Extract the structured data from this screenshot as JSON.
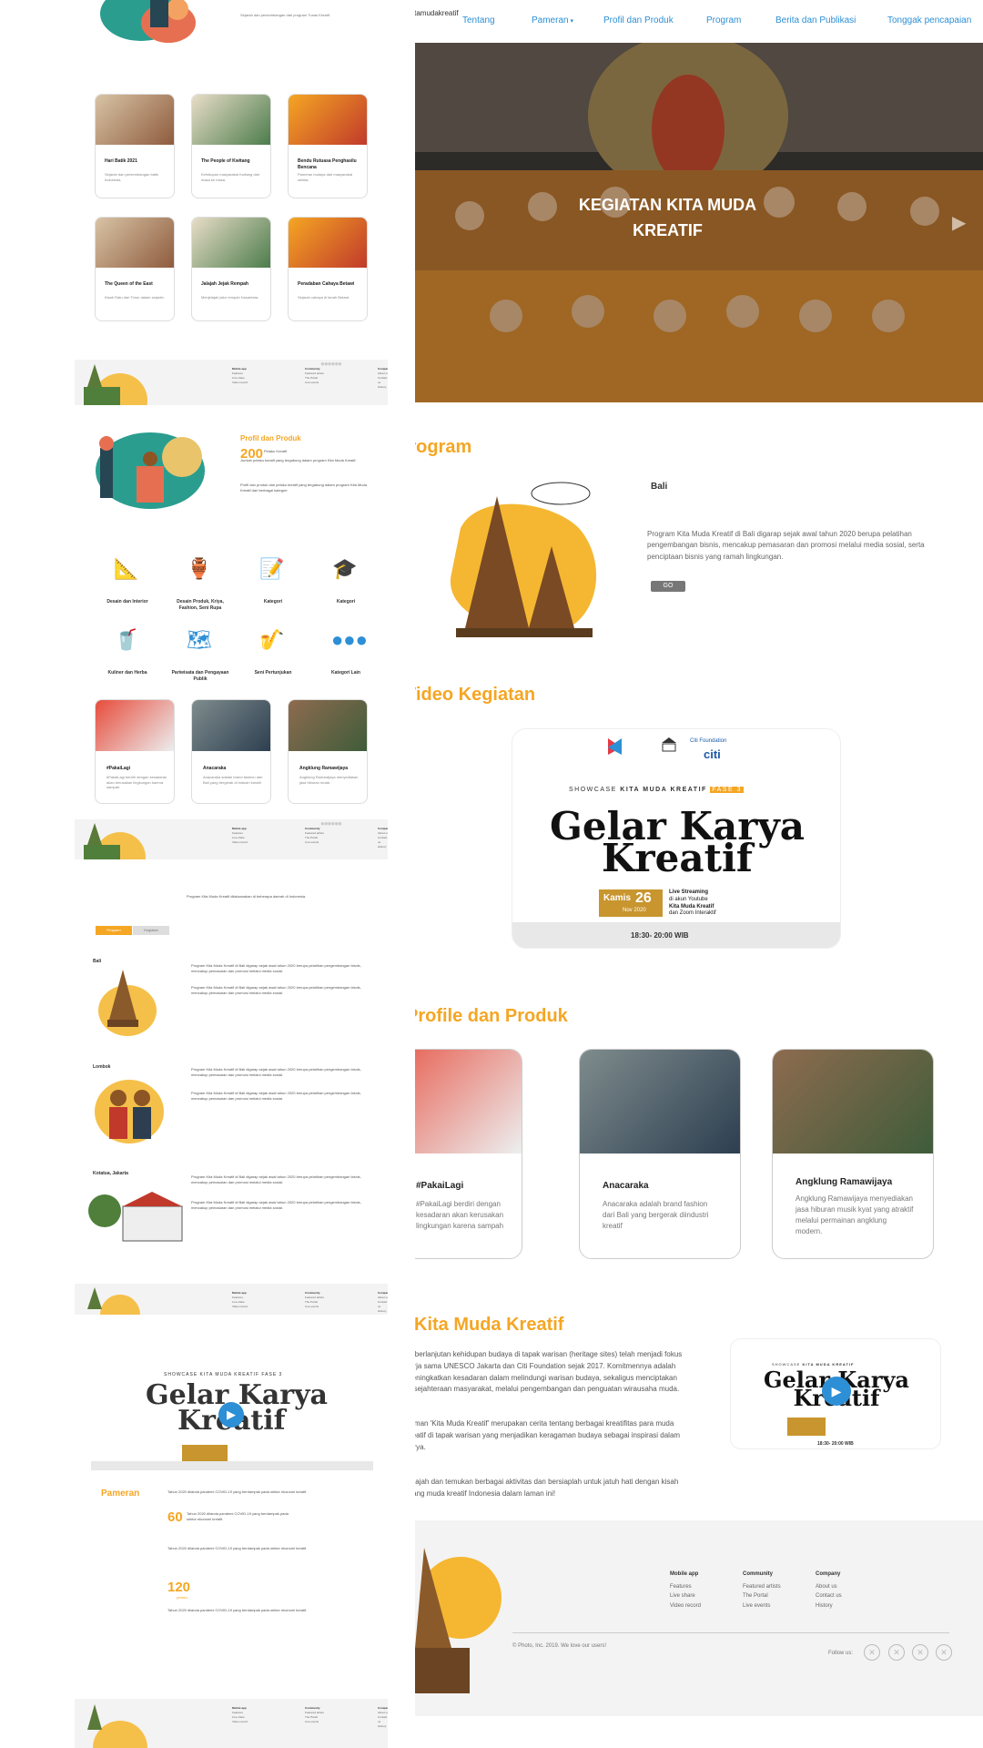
{
  "left": {
    "top_text": "Sejarah dan perkembangan dari program Tunas Kreatif.",
    "cards1": [
      {
        "title": "Hari Batik 2021",
        "desc": "Sejarah dan perkembangan batik Indonesia."
      },
      {
        "title": "The People of Kwitang",
        "desc": "Kehidupan masyarakat Kwitang dari masa ke masa."
      },
      {
        "title": "Bendu Rutuasa Penghasilu Bencana",
        "desc": "Pameran budaya dari masyarakat sekitar."
      }
    ],
    "cards2": [
      {
        "title": "The Queen of the East",
        "desc": "Kisah Ratu dari Timur dalam sejarah."
      },
      {
        "title": "Jalajah Jejak Rempah",
        "desc": "Menjelajah jalur rempah Nusantara."
      },
      {
        "title": "Peradaban Cahaya Betawi",
        "desc": "Sejarah cahaya di tanah Betawi."
      }
    ],
    "footer_cols": [
      {
        "title": "Mobile app",
        "items": [
          "Features",
          "Live share",
          "Video record"
        ]
      },
      {
        "title": "Community",
        "items": [
          "Featured artists",
          "The Portal",
          "Live events"
        ]
      },
      {
        "title": "Company",
        "items": [
          "About us",
          "Contact us",
          "History"
        ]
      }
    ],
    "profile_title": "Profil dan Produk",
    "profile_num": "200",
    "profile_num_label": "Pelaku Kreatif",
    "profile_desc": "Jumlah pelaku kreatif yang tergabung dalam program Kita Muda Kreatif.",
    "profile_desc2": "Profil dan produk dari pelaku kreatif yang tergabung dalam program Kita Muda Kreatif dari berbagai kategori.",
    "categories": [
      "Desain dan Interior",
      "Desain Produk, Kriya, Fashion, Seni Rupa",
      "Kategori",
      "Kategori",
      "Kuliner dan Herba",
      "Pariwisata dan Pengayaan Publik",
      "Seni Pertunjukan",
      "Kategori Lain"
    ],
    "profile_cards": [
      {
        "title": "#PakaiLagi",
        "desc": "#PakaiLagi berdiri dengan kesadaran akan kerusakan lingkungan karena sampah."
      },
      {
        "title": "Anacaraka",
        "desc": "Anacaraka adalah brand fashion dari Bali yang bergerak di industri kreatif."
      },
      {
        "title": "Angklung Ramawijaya",
        "desc": "Angklung Ramawijaya menyediakan jasa hiburan musik."
      }
    ],
    "program_intro": "Program Kita Muda Kreatif dilaksanakan di beberapa daerah di Indonesia.",
    "tab1": "Program",
    "tab2": "Kegiatan",
    "regions": [
      "Bali",
      "Lombok",
      "Kotatua, Jakarta"
    ],
    "region_text": "Program Kita Muda Kreatif di Bali digarap sejak awal tahun 2020 berupa pelatihan pengembangan bisnis, mencakup pemasaran dan promosi melalui media sosial.",
    "video_title_1": "Gelar Karya",
    "video_title_2": "Kreatif",
    "video_showcase": "SHOWCASE KITA MUDA KREATIF FASE 3",
    "pameran_title": "Pameran",
    "pameran_num1": "60",
    "pameran_num2": "120",
    "pameran_unit2": "pelaku",
    "pameran_text": "Tahun 2020 dilanda pandemi COVID-19 yang berdampak pada sektor ekonomi kreatif."
  },
  "right": {
    "brand": "Kitamudakreatif",
    "nav": [
      "Tentang",
      "Pameran",
      "Profil dan Produk",
      "Program",
      "Berita dan Publikasi",
      "Tonggak pencapaian"
    ],
    "hero_title_1": "KEGIATAN KITA MUDA",
    "hero_title_2": "KREATIF",
    "program_heading": "Program",
    "program_region": "Bali",
    "program_text": "Program Kita Muda Kreatif di Bali digarap sejak awal tahun 2020 berupa pelatihan pengembangan bisnis, mencakup pemasaran dan promosi melalui media sosial, serta penciptaan bisnis yang ramah lingkungan.",
    "go_button": "GO",
    "video_heading": "Video Kegiatan",
    "video": {
      "showcase_pre": "SHOWCASE",
      "showcase_bold": "KITA MUDA KREATIF",
      "showcase_tag": "FASE 3",
      "title_1": "Gelar Karya",
      "title_2": "Kreatif",
      "day": "Kamis",
      "date": "26",
      "month": "Nov 2020",
      "stream_1": "Live Streaming",
      "stream_2": "di akun Youtube",
      "stream_3": "Kita Muda Kreatif",
      "stream_4": "dan Zoom Interaktif",
      "time": "18:30- 20:00 WIB",
      "logo_citi": "citi",
      "logo_foundation": "Citi Foundation"
    },
    "profile_heading": "Profile dan Produk",
    "cards": [
      {
        "title": "#PakaiLagi",
        "desc": "#PakaiLagi berdiri dengan kesadaran akan kerusakan lingkungan karena sampah"
      },
      {
        "title": "Anacaraka",
        "desc": "Anacaraka adalah brand fashion dari Bali yang bergerak diindustri kreatif"
      },
      {
        "title": "Angklung Ramawijaya",
        "desc": "Angklung Ramawijaya menyediakan jasa hiburan musik kyat yang atraktif melalui permainan angklung modern."
      }
    ],
    "kmk_heading": "Kita Muda Kreatif",
    "kmk_p1": "Keberlanjutan kehidupan budaya di tapak warisan (heritage sites) telah menjadi fokus kerja sama UNESCO Jakarta dan Citi Foundation sejak 2017. Komitmennya adalah meningkatkan kesadaran dalam melindungi warisan budaya, sekaligus menciptakan kesejahteraan masyarakat, melalui pengembangan dan penguatan wirausaha muda.",
    "kmk_p2": "Laman 'Kita Muda Kreatif' merupakan cerita tentang berbagai kreatifitas para muda kreatif di tapak warisan yang menjadikan keragaman budaya sebagai inspirasi dalam karya.",
    "kmk_p3": "Jelajah dan temukan berbagai aktivitas dan bersiaplah untuk jatuh hati dengan kisah orang muda kreatif Indonesia dalam laman ini!",
    "footer_cols": [
      {
        "title": "Mobile app",
        "items": [
          "Features",
          "Live share",
          "Video record"
        ]
      },
      {
        "title": "Community",
        "items": [
          "Featured artists",
          "The Portal",
          "Live events"
        ]
      },
      {
        "title": "Company",
        "items": [
          "About us",
          "Contact us",
          "History"
        ]
      }
    ],
    "copyright": "© Photo, Inc. 2019. We love our users!",
    "follow_us": "Follow us:"
  },
  "colors": {
    "accent": "#f5a623",
    "link": "#2d8fd5",
    "footer_bg": "#f3f3f3"
  }
}
